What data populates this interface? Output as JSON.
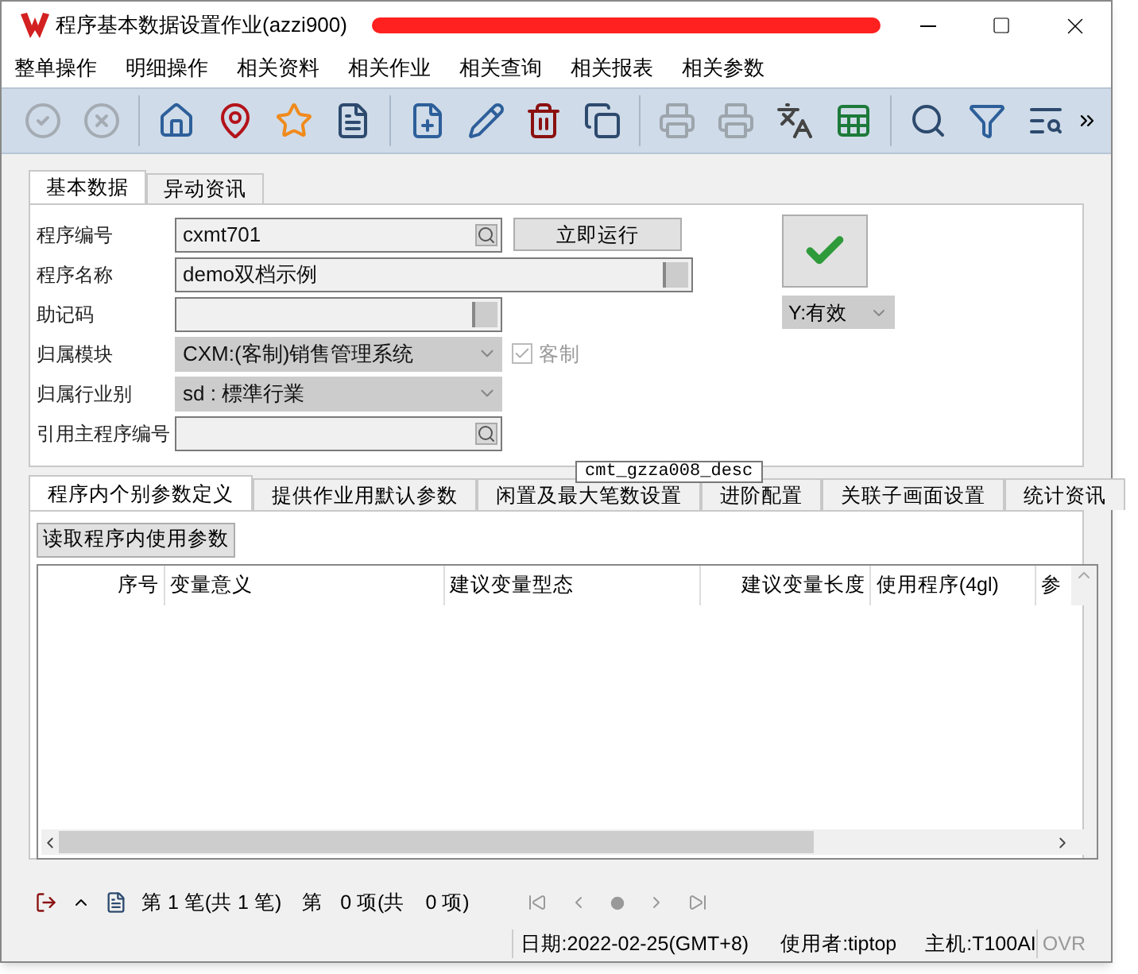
{
  "window": {
    "title": "程序基本数据设置作业(azzi900)"
  },
  "menu": [
    "整单操作",
    "明细操作",
    "相关资料",
    "相关作业",
    "相关查询",
    "相关报表",
    "相关参数"
  ],
  "toolbar": [
    {
      "kind": "confirm",
      "disabled": true
    },
    {
      "kind": "cancel",
      "disabled": true
    },
    {
      "kind": "sep"
    },
    {
      "kind": "home",
      "disabled": false
    },
    {
      "kind": "pin",
      "disabled": false
    },
    {
      "kind": "star",
      "disabled": false
    },
    {
      "kind": "list",
      "disabled": false
    },
    {
      "kind": "sep"
    },
    {
      "kind": "add",
      "disabled": false
    },
    {
      "kind": "edit",
      "disabled": false
    },
    {
      "kind": "delete",
      "disabled": false
    },
    {
      "kind": "copy",
      "disabled": false
    },
    {
      "kind": "sep"
    },
    {
      "kind": "print",
      "disabled": true
    },
    {
      "kind": "print2",
      "disabled": true
    },
    {
      "kind": "translate",
      "disabled": false
    },
    {
      "kind": "excel",
      "disabled": false
    },
    {
      "kind": "sep"
    },
    {
      "kind": "search",
      "disabled": false
    },
    {
      "kind": "filter",
      "disabled": false
    },
    {
      "kind": "query",
      "disabled": false
    }
  ],
  "top_tabs": [
    {
      "label": "基本数据",
      "selected": true
    },
    {
      "label": "异动资讯",
      "selected": false
    }
  ],
  "fields": [
    {
      "label": "程序编号",
      "value": "cxmt701",
      "kind": "lookup"
    },
    {
      "label": "程序名称",
      "value": "demo双档示例",
      "kind": "text"
    },
    {
      "label": "助记码",
      "kind": "text"
    },
    {
      "label": "归属模块",
      "value": "CXM:(客制)销售管理系统",
      "kind": "combo"
    },
    {
      "label": "归属行业别",
      "value": "sd : 標準行業",
      "kind": "combo"
    },
    {
      "label": "引用主程序编号",
      "kind": "lookup"
    }
  ],
  "run_button": "立即运行",
  "custom_checkbox": {
    "label": "客制",
    "checked": true,
    "disabled": true
  },
  "status_select": {
    "value": "Y:有效"
  },
  "detail_tabs": [
    {
      "label": "程序内个别参数定义",
      "selected": true
    },
    {
      "label": "提供作业用默认参数",
      "selected": false
    },
    {
      "label": "闲置及最大笔数设置",
      "selected": false
    },
    {
      "label": "进阶配置",
      "selected": false
    },
    {
      "label": "关联子画面设置",
      "selected": false
    },
    {
      "label": "统计资讯",
      "selected": false
    }
  ],
  "tooltip": "cmt_gzza008_desc",
  "read_button": "读取程序内使用参数",
  "table": {
    "columns": [
      "序号",
      "变量意义",
      "建议变量型态",
      "建议变量长度",
      "使用程序(4gl)",
      "参"
    ]
  },
  "nav": {
    "record": "第 1 笔(共 1 笔)",
    "item_prefix": "第",
    "item": "0 项(共",
    "item_total": "0 项)"
  },
  "status_bar": {
    "date": "日期:2022-02-25(GMT+8)",
    "user": "使用者:tiptop",
    "host": "主机:T100AI",
    "mode": "OVR"
  }
}
